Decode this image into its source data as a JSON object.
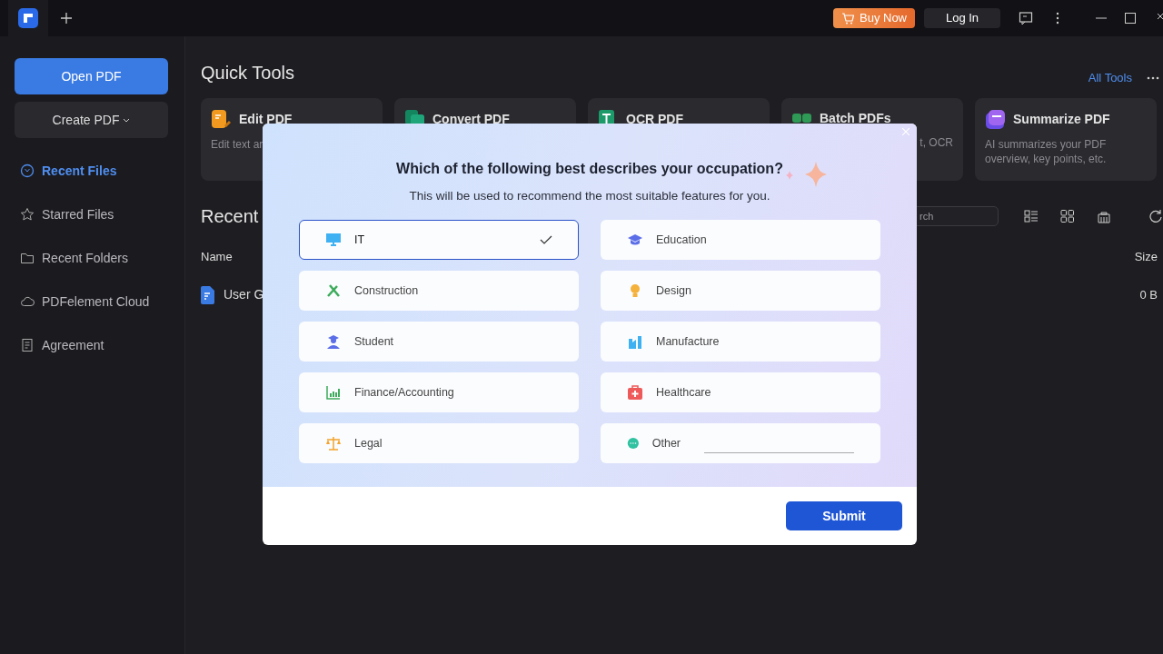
{
  "titlebar": {
    "buttons": [
      {
        "kind": "buy",
        "label": "Buy Now"
      },
      {
        "kind": "login",
        "label": "Log In"
      }
    ]
  },
  "sidebar": {
    "open_button": "Open PDF",
    "create_button": "Create PDF",
    "items": [
      {
        "label": "Recent Files",
        "selected": true
      },
      {
        "label": "Starred Files",
        "selected": false
      },
      {
        "label": "Recent Folders",
        "selected": false
      },
      {
        "label": "PDFelement Cloud",
        "selected": false
      },
      {
        "label": "Agreement",
        "selected": false
      }
    ]
  },
  "quick_tools": {
    "title": "Quick Tools",
    "all_tools": "All Tools",
    "tools": [
      {
        "title": "Edit PDF",
        "description": "Edit text ar"
      },
      {
        "title": "Convert PDF"
      },
      {
        "title": "OCR PDF"
      },
      {
        "title": "Batch PDFs",
        "description": "t, OCR"
      },
      {
        "title": "Summarize PDF",
        "description": "AI summarizes your PDF overview, key points, etc."
      }
    ]
  },
  "recent": {
    "title": "Recent",
    "search": {
      "placeholder": "rch"
    },
    "columns": [
      "Name",
      "Size"
    ],
    "rows": [
      {
        "name": "User G",
        "size": "0 B"
      }
    ]
  },
  "dialog": {
    "title": "Which of the following best describes your occupation?",
    "subtitle": "This will be used to recommend the most suitable features for you.",
    "options": [
      {
        "kind": "choice",
        "label": "IT",
        "selected": true
      },
      {
        "kind": "choice",
        "label": "Education",
        "selected": false
      },
      {
        "kind": "choice",
        "label": "Construction",
        "selected": false
      },
      {
        "kind": "choice",
        "label": "Design",
        "selected": false
      },
      {
        "kind": "choice",
        "label": "Student",
        "selected": false
      },
      {
        "kind": "choice",
        "label": "Manufacture",
        "selected": false
      },
      {
        "kind": "choice",
        "label": "Finance/Accounting",
        "selected": false
      },
      {
        "kind": "choice",
        "label": "Healthcare",
        "selected": false
      },
      {
        "kind": "choice",
        "label": "Legal",
        "selected": false
      },
      {
        "kind": "other",
        "label": "Other",
        "selected": false
      }
    ],
    "submit": "Submit"
  }
}
